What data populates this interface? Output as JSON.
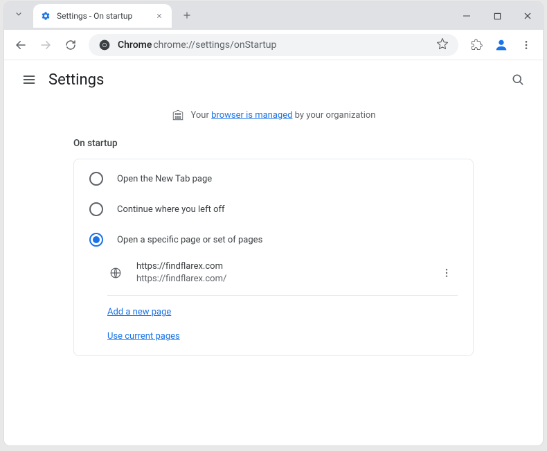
{
  "tab": {
    "title": "Settings - On startup"
  },
  "omnibox": {
    "chrome_label": "Chrome",
    "url": "chrome://settings/onStartup"
  },
  "header": {
    "title": "Settings"
  },
  "managed": {
    "prefix": "Your ",
    "link": "browser is managed",
    "suffix": " by your organization"
  },
  "section": {
    "title": "On startup"
  },
  "startup": {
    "options": [
      {
        "label": "Open the New Tab page",
        "selected": false
      },
      {
        "label": "Continue where you left off",
        "selected": false
      },
      {
        "label": "Open a specific page or set of pages",
        "selected": true
      }
    ],
    "pages": [
      {
        "name": "https://findflarex.com",
        "url": "https://findflarex.com/"
      }
    ],
    "add_page": "Add a new page",
    "use_current": "Use current pages"
  }
}
